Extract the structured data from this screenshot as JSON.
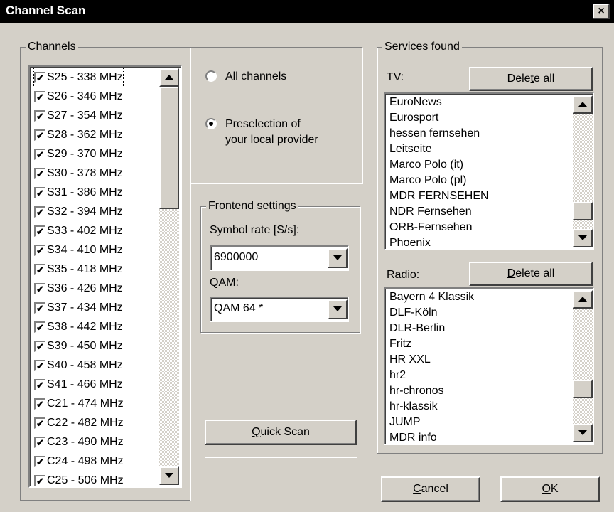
{
  "window": {
    "title": "Channel Scan",
    "close_glyph": "×"
  },
  "channels": {
    "legend": "Channels",
    "items": [
      {
        "label": "S25 - 338 MHz",
        "checked": true
      },
      {
        "label": "S26 - 346 MHz",
        "checked": true
      },
      {
        "label": "S27 - 354 MHz",
        "checked": true
      },
      {
        "label": "S28 - 362 MHz",
        "checked": true
      },
      {
        "label": "S29 - 370 MHz",
        "checked": true
      },
      {
        "label": "S30 - 378 MHz",
        "checked": true
      },
      {
        "label": "S31 - 386 MHz",
        "checked": true
      },
      {
        "label": "S32 - 394 MHz",
        "checked": true
      },
      {
        "label": "S33 - 402 MHz",
        "checked": true
      },
      {
        "label": "S34 - 410 MHz",
        "checked": true
      },
      {
        "label": "S35 - 418 MHz",
        "checked": true
      },
      {
        "label": "S36 - 426 MHz",
        "checked": true
      },
      {
        "label": "S37 - 434 MHz",
        "checked": true
      },
      {
        "label": "S38 - 442 MHz",
        "checked": true
      },
      {
        "label": "S39 - 450 MHz",
        "checked": true
      },
      {
        "label": "S40 - 458 MHz",
        "checked": true
      },
      {
        "label": "S41 - 466 MHz",
        "checked": true
      },
      {
        "label": "C21 - 474 MHz",
        "checked": true
      },
      {
        "label": "C22 - 482 MHz",
        "checked": true
      },
      {
        "label": "C23 - 490 MHz",
        "checked": true
      },
      {
        "label": "C24 - 498 MHz",
        "checked": true
      },
      {
        "label": "C25 - 506 MHz",
        "checked": true
      }
    ]
  },
  "scan_mode": {
    "options": [
      {
        "label": "All channels",
        "selected": false
      },
      {
        "label_line1": "Preselection of",
        "label_line2": "your local provider",
        "selected": true
      }
    ]
  },
  "frontend": {
    "legend": "Frontend settings",
    "symbol_rate_label": "Symbol rate [S/s]:",
    "symbol_rate_value": "6900000",
    "qam_label": "QAM:",
    "qam_value": "QAM 64 *"
  },
  "quick_scan": {
    "pre": "",
    "mnemonic": "Q",
    "post": "uick Scan"
  },
  "services": {
    "legend": "Services found",
    "tv_label": "TV:",
    "tv_delete": {
      "pre": "Dele",
      "mnemonic": "t",
      "post": "e all"
    },
    "tv_items": [
      "EuroNews",
      "Eurosport",
      "hessen fernsehen",
      "Leitseite",
      "Marco Polo (it)",
      "Marco Polo (pl)",
      "MDR FERNSEHEN",
      "NDR Fernsehen",
      "ORB-Fernsehen",
      "Phoenix"
    ],
    "radio_label": "Radio:",
    "radio_delete": {
      "pre": "",
      "mnemonic": "D",
      "post": "elete all"
    },
    "radio_items": [
      "Bayern 4 Klassik",
      "DLF-Köln",
      "DLR-Berlin",
      "Fritz",
      "HR XXL",
      "hr2",
      "hr-chronos",
      "hr-klassik",
      "JUMP",
      "MDR info"
    ]
  },
  "footer": {
    "cancel": {
      "pre": "",
      "mnemonic": "C",
      "post": "ancel"
    },
    "ok": {
      "pre": "",
      "mnemonic": "O",
      "post": "K"
    }
  },
  "icons": {
    "check": "check-icon",
    "arrow_up": "arrow-up-icon",
    "arrow_down": "arrow-down-icon",
    "close": "close-icon"
  }
}
